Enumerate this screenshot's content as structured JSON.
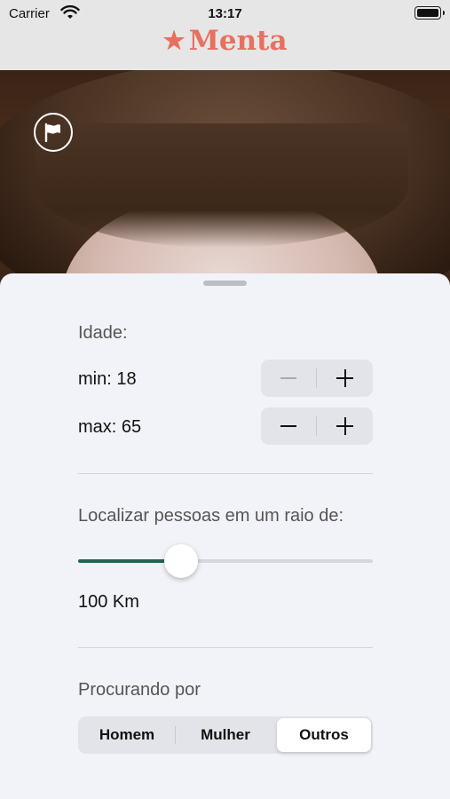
{
  "status_bar": {
    "carrier": "Carrier",
    "time": "13:17"
  },
  "app": {
    "brand": "Menta",
    "brand_color": "#e8705e"
  },
  "age": {
    "label": "Idade:",
    "min_label": "min: 18",
    "max_label": "max: 65",
    "min_value": 18,
    "max_value": 65
  },
  "distance": {
    "label": "Localizar pessoas em um raio de:",
    "value_text": "100 Km",
    "slider_fraction": 0.35,
    "accent": "#1f6650"
  },
  "seeking": {
    "label": "Procurando por",
    "options": [
      "Homem",
      "Mulher",
      "Outros"
    ],
    "selected": "Outros"
  },
  "icons": {
    "wifi": "wifi-icon",
    "battery": "battery-icon",
    "brand_star": "star-icon",
    "report": "flag-icon",
    "decrement": "minus-icon",
    "increment": "plus-icon"
  }
}
